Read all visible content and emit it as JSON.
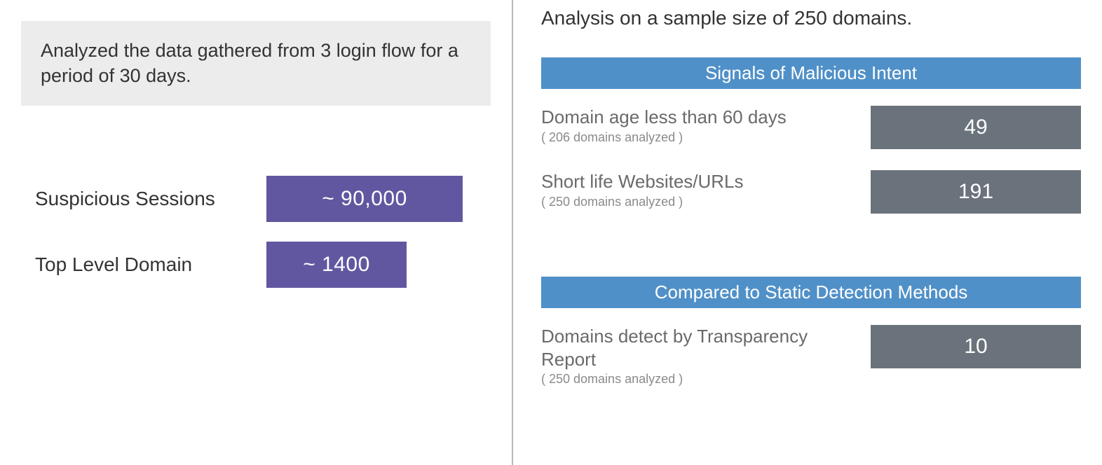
{
  "left": {
    "intro": "Analyzed the data gathered from 3 login flow for a period of 30 days.",
    "stats": [
      {
        "label": "Suspicious Sessions",
        "value": "~ 90,000",
        "size": "wide"
      },
      {
        "label": "Top Level Domain",
        "value": "~ 1400",
        "size": "narrow"
      }
    ]
  },
  "right": {
    "sample_line": "Analysis on a sample size of 250 domains.",
    "sections": [
      {
        "header": "Signals of Malicious Intent",
        "rows": [
          {
            "title": "Domain age less than 60 days",
            "sub": "( 206 domains analyzed )",
            "value": "49"
          },
          {
            "title": "Short life Websites/URLs",
            "sub": "( 250 domains analyzed )",
            "value": "191"
          }
        ]
      },
      {
        "header": "Compared to Static Detection Methods",
        "rows": [
          {
            "title": "Domains detect by Transparency Report",
            "sub": "( 250 domains analyzed )",
            "value": "10"
          }
        ]
      }
    ]
  }
}
